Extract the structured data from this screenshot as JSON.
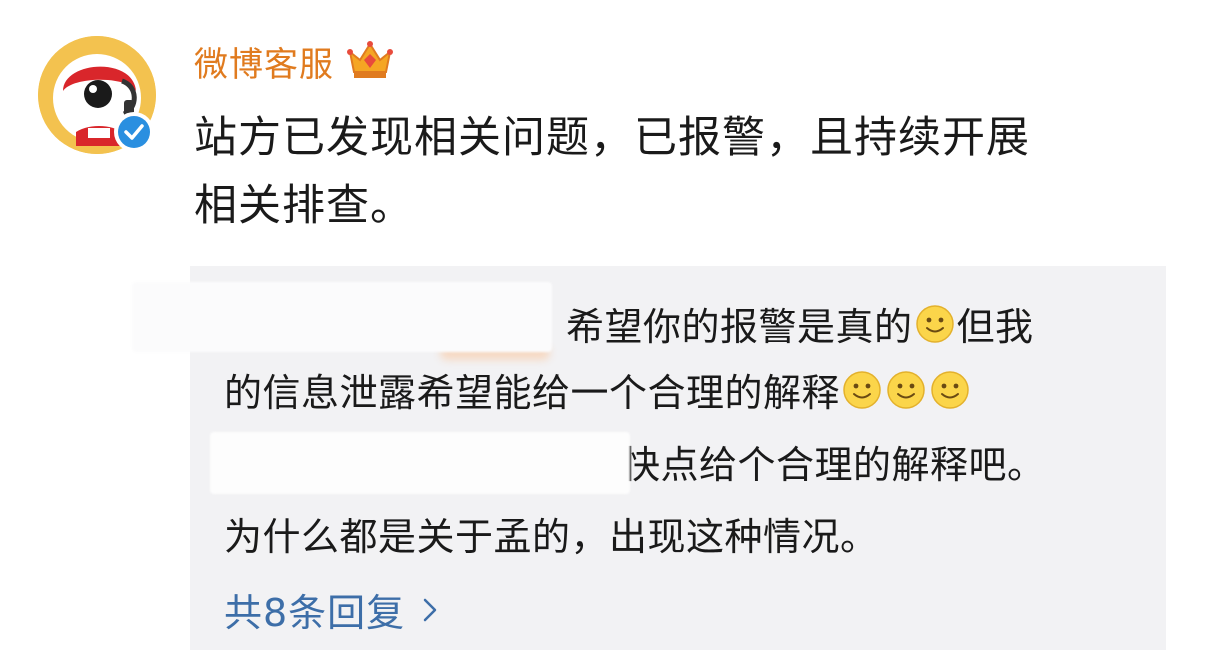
{
  "post": {
    "username": "微博客服",
    "badge_icon": "crown-vip-icon",
    "verified_icon": "verified-check-icon",
    "content_line1": "站方已发现相关问题，已报警，且持续开展",
    "content_line2": "相关排查。"
  },
  "replies": {
    "line1_text": "希望你的报警是真的",
    "line1_suffix": "但我",
    "line2_text": "的信息泄露希望能给一个合理的解释",
    "line3_text": "快点给个合理的解释吧。",
    "line4_text": "为什么都是关于孟的，出现这种情况。",
    "more_label": "共8条回复",
    "smiley_icon": "smiley-emoji-icon",
    "chevron_icon": "chevron-right-icon"
  },
  "colors": {
    "username": "#e07b1f",
    "link": "#3d6ea8",
    "reply_bg": "#f2f2f4",
    "verified": "#2a8fe0"
  }
}
